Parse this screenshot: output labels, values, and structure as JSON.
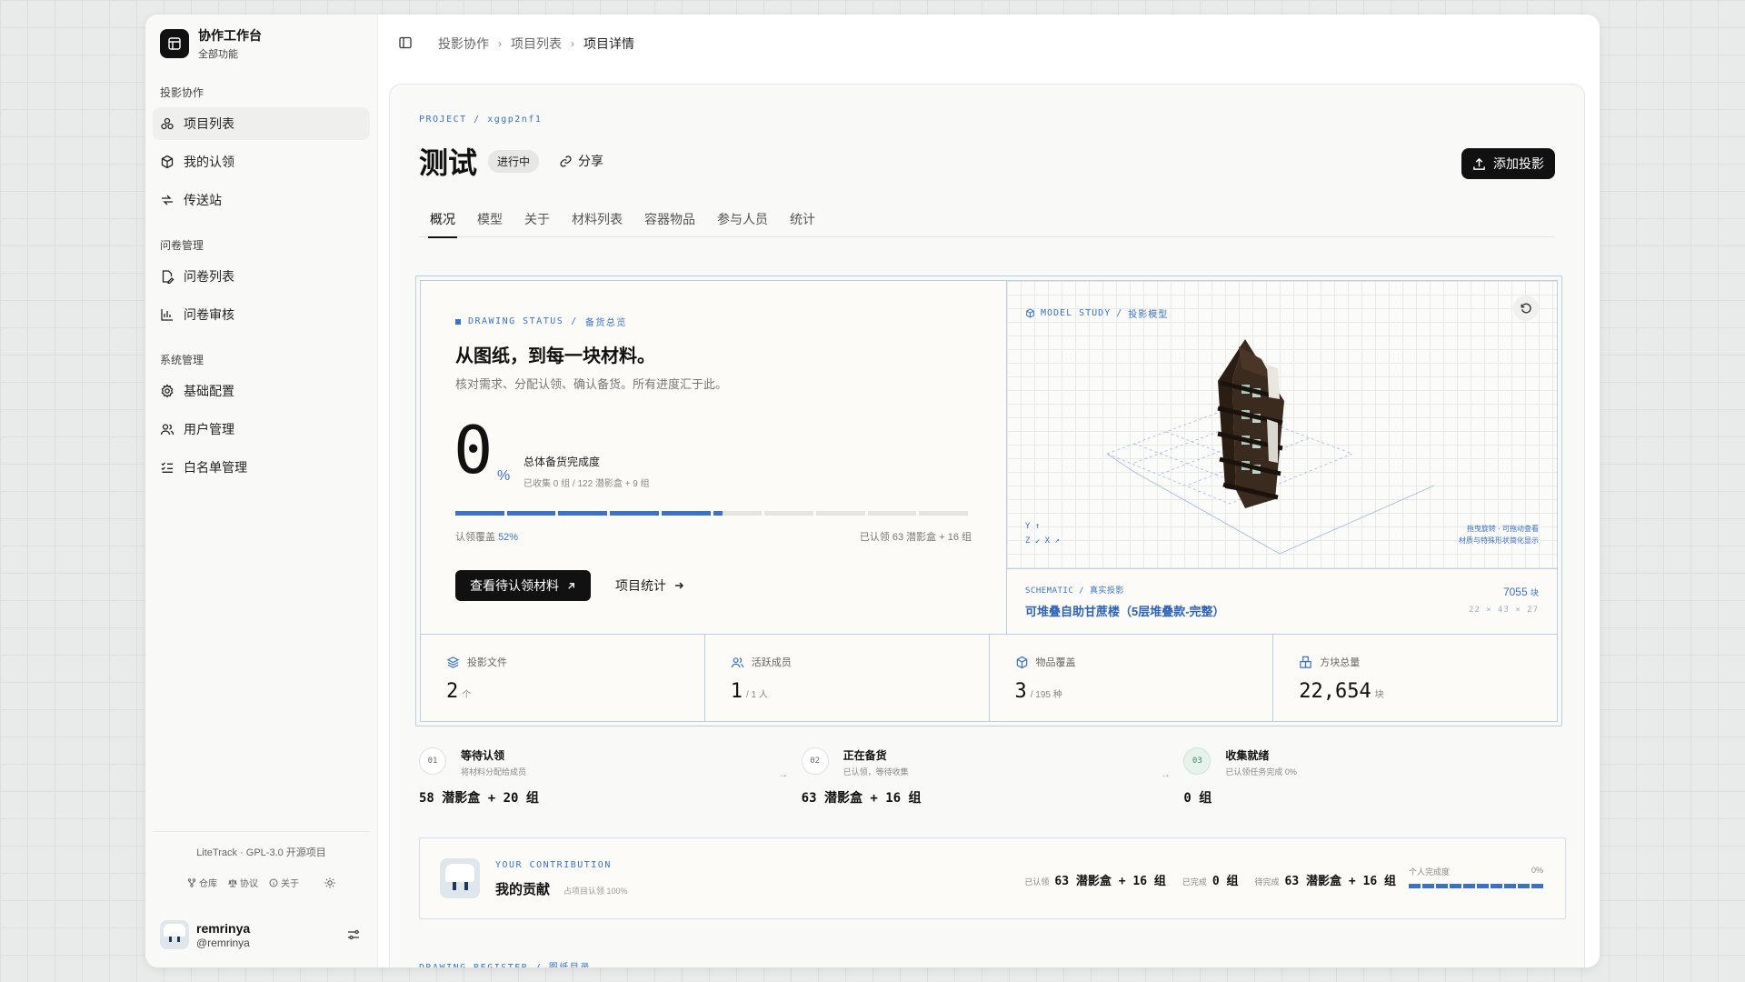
{
  "sidebar": {
    "brand_title": "协作工作台",
    "brand_sub": "全部功能",
    "sections": [
      {
        "label": "投影协作",
        "items": [
          "项目列表",
          "我的认领",
          "传送站"
        ]
      },
      {
        "label": "问卷管理",
        "items": [
          "问卷列表",
          "问卷审核"
        ]
      },
      {
        "label": "系统管理",
        "items": [
          "基础配置",
          "用户管理",
          "白名单管理"
        ]
      }
    ],
    "footer_text": "LiteTrack · GPL-3.0 开源项目",
    "footer_links": [
      "仓库",
      "协议",
      "关于"
    ],
    "user_name": "remrinya",
    "user_handle": "@remrinya"
  },
  "breadcrumb": [
    "投影协作",
    "项目列表",
    "项目详情"
  ],
  "project": {
    "code": "PROJECT / xggp2nf1",
    "title": "测试",
    "status": "进行中",
    "share_label": "分享",
    "add_label": "添加投影"
  },
  "tabs": [
    "概况",
    "模型",
    "关于",
    "材料列表",
    "容器物品",
    "参与人员",
    "统计"
  ],
  "overview": {
    "label_a": "DRAWING STATUS",
    "label_b": "备货总览",
    "headline": "从图纸，到每一块材料。",
    "subtext": "核对需求、分配认领、确认备货。所有进度汇于此。",
    "big_number": "0",
    "percent_sign": "%",
    "progress_title": "总体备货完成度",
    "progress_sub": "已收集 0 组 / 122 潜影盒 + 9 组",
    "coverage_label": "认领覆盖",
    "coverage_value": "52%",
    "coverage_fraction": 0.52,
    "segments": 10,
    "claimed_text": "已认领 63 潜影盒 + 16 组",
    "primary_btn": "查看待认领材料",
    "secondary_btn": "项目统计"
  },
  "model": {
    "label_a": "MODEL STUDY",
    "label_b": "投影模型",
    "axes_line1": "Y ↑",
    "axes_line2": "Z ↙  X ↗",
    "hint_line1": "拖曳旋转 · 可拖动查看",
    "hint_line2": "材质与特殊形状简化显示",
    "schematic_code": "SCHEMATIC / 真实投影",
    "schematic_name": "可堆叠自助甘蔗楼（5层堆叠款-完整）",
    "blocks_count": "7055",
    "blocks_unit": "块",
    "dims": "22 × 43 × 27"
  },
  "stats": [
    {
      "label": "投影文件",
      "value": "2",
      "unit": "个",
      "icon": "layers-icon"
    },
    {
      "label": "活跃成员",
      "value": "1",
      "unit": "/ 1 人",
      "icon": "users-icon"
    },
    {
      "label": "物品覆盖",
      "value": "3",
      "unit": "/ 195 种",
      "icon": "box-icon"
    },
    {
      "label": "方块总量",
      "value": "22,654",
      "unit": "块",
      "icon": "blocks-icon"
    }
  ],
  "pipeline": [
    {
      "num": "01",
      "title": "等待认领",
      "sub": "将材料分配给成员",
      "value": "58 潜影盒 + 20 组"
    },
    {
      "num": "02",
      "title": "正在备货",
      "sub": "已认领，等待收集",
      "value": "63 潜影盒 + 16 组"
    },
    {
      "num": "03",
      "title": "收集就绪",
      "sub": "已认领任务完成 0%",
      "value": "0 组"
    }
  ],
  "contribution": {
    "code": "YOUR CONTRIBUTION",
    "title": "我的贡献",
    "sub": "占项目认领 100%",
    "claimed_label": "已认领",
    "claimed_value": "63 潜影盒 + 16 组",
    "done_label": "已完成",
    "done_value": "0 组",
    "pending_label": "待完成",
    "pending_value": "63 潜影盒 + 16 组",
    "progress_label": "个人完成度",
    "progress_value": "0%"
  },
  "register_label": "DRAWING REGISTER / 图纸目录",
  "colors": {
    "accent": "#3b72c7",
    "dark": "#111111",
    "border": "#b9cfe9"
  }
}
